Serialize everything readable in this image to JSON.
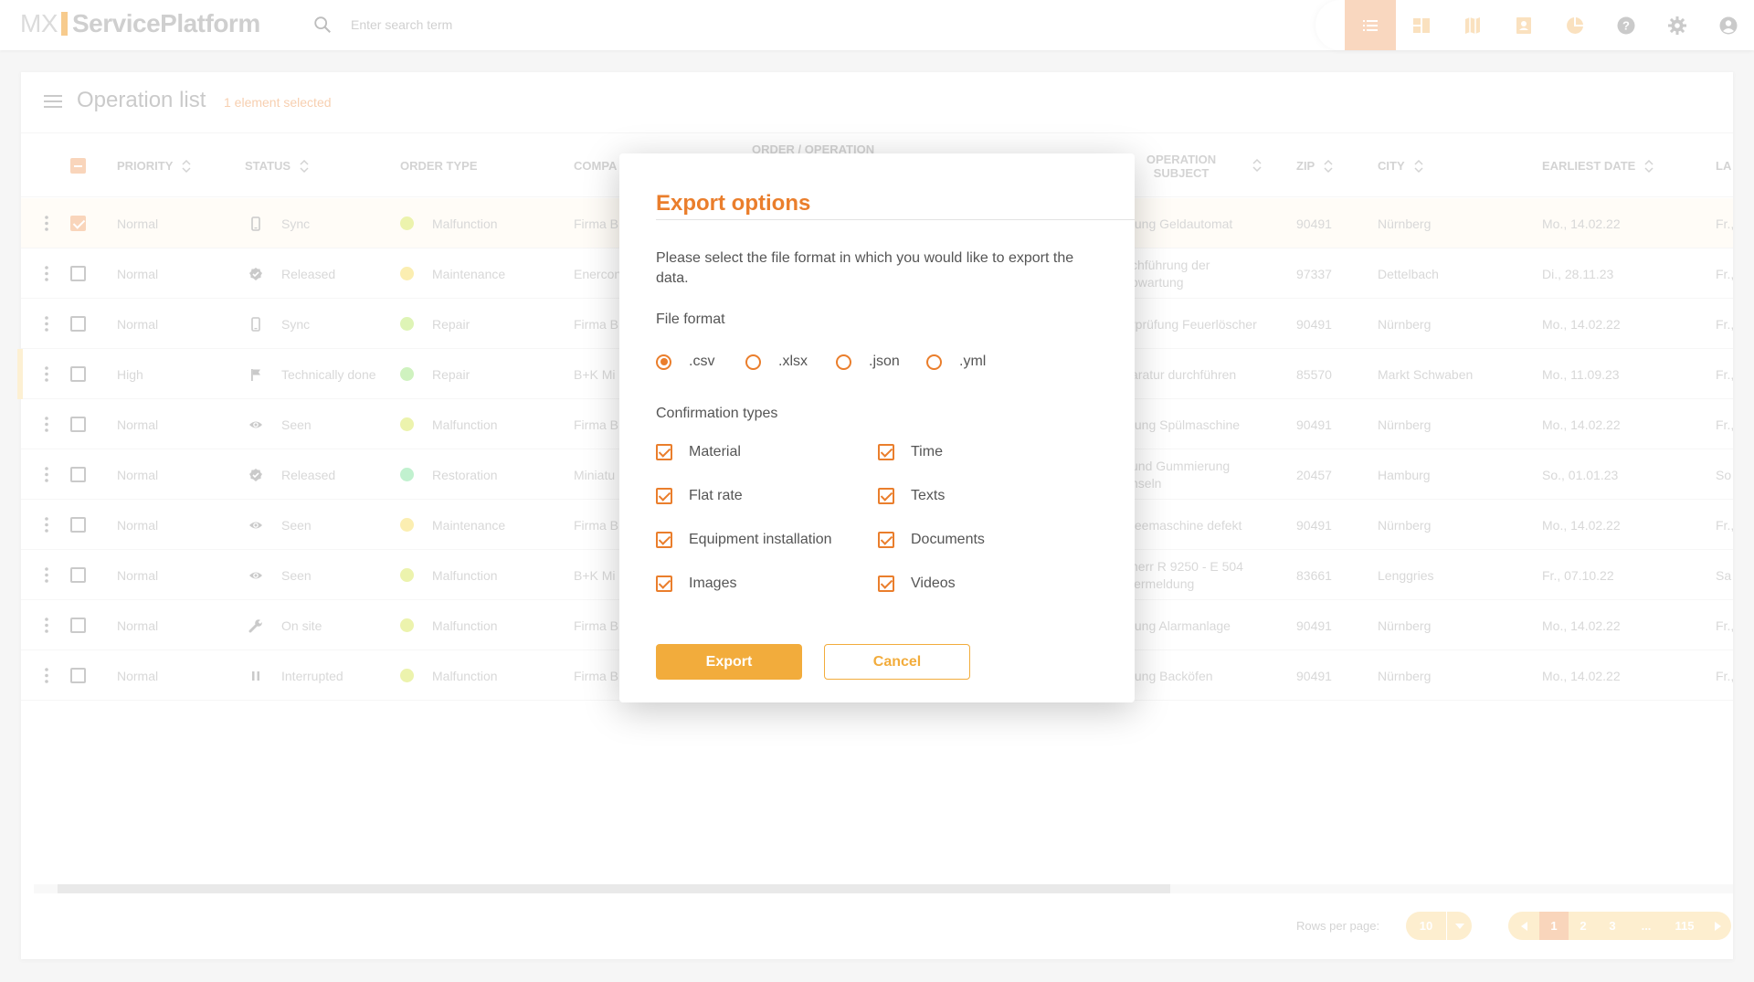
{
  "app": {
    "logo_mx": "MX",
    "logo_name": "ServicePlatform",
    "search_placeholder": "Enter search term",
    "nav": [
      {
        "name": "list-view",
        "icon": "list-icon",
        "active": true
      },
      {
        "name": "dashboard-view",
        "icon": "dashboard-icon",
        "active": false
      },
      {
        "name": "map-view",
        "icon": "map-icon",
        "active": false
      },
      {
        "name": "contacts-view",
        "icon": "contact-icon",
        "active": false
      },
      {
        "name": "reports-view",
        "icon": "pie-chart-icon",
        "active": false
      },
      {
        "name": "help",
        "icon": "help-icon",
        "active": false
      },
      {
        "name": "settings",
        "icon": "gear-icon",
        "active": false
      },
      {
        "name": "account",
        "icon": "user-icon",
        "active": false
      }
    ]
  },
  "list": {
    "title": "Operation list",
    "selected_text": "1 element selected",
    "columns": {
      "priority": "PRIORITY",
      "status": "STATUS",
      "order_type": "ORDER TYPE",
      "company": "COMPA",
      "order_operation": "ORDER / OPERATION",
      "subject_l1": "OPERATION",
      "subject_l2": "SUBJECT",
      "zip": "ZIP",
      "city": "CITY",
      "earliest_date": "EARLIEST DATE",
      "last": "LA"
    },
    "rows": [
      {
        "priority": "Normal",
        "status": "Sync",
        "status_icon": "phone-icon",
        "order_type": "Malfunction",
        "type_color": "#dde96a",
        "company": "Firma B",
        "subject": "tung Geldautomat",
        "zip": "90491",
        "city": "Nürnberg",
        "date": "Mo., 14.02.22",
        "last": "Fr.,",
        "selected": true,
        "high": false
      },
      {
        "priority": "Normal",
        "status": "Released",
        "status_icon": "verified-icon",
        "order_type": "Maintenance",
        "type_color": "#f7e171",
        "company": "Enercon",
        "subject": "chführung der\nowartung",
        "zip": "97337",
        "city": "Dettelbach",
        "date": "Di., 28.11.23",
        "last": "Fr.,",
        "selected": false,
        "high": false
      },
      {
        "priority": "Normal",
        "status": "Sync",
        "status_icon": "phone-icon",
        "order_type": "Repair",
        "type_color": "#c4ec7a",
        "company": "Firma B",
        "subject": "rprüfung Feuerlöscher",
        "zip": "90491",
        "city": "Nürnberg",
        "date": "Mo., 14.02.22",
        "last": "Fr.,",
        "selected": false,
        "high": false
      },
      {
        "priority": "High",
        "status": "Technically done",
        "status_icon": "flag-icon",
        "order_type": "Repair",
        "type_color": "#a8e88a",
        "company": "B+K Mi",
        "subject": "aratur durchführen",
        "zip": "85570",
        "city": "Markt Schwaben",
        "date": "Mo., 11.09.23",
        "last": "Fr.,",
        "selected": false,
        "high": true
      },
      {
        "priority": "Normal",
        "status": "Seen",
        "status_icon": "eye-icon",
        "order_type": "Malfunction",
        "type_color": "#dde96a",
        "company": "Firma B",
        "subject": "tung Spülmaschine",
        "zip": "90491",
        "city": "Nürnberg",
        "date": "Mo., 14.02.22",
        "last": "Fr.,",
        "selected": false,
        "high": false
      },
      {
        "priority": "Normal",
        "status": "Released",
        "status_icon": "verified-icon",
        "order_type": "Restoration",
        "type_color": "#8ee6a8",
        "company": "Miniatu",
        "subject": "und Gummierung\nhseln",
        "zip": "20457",
        "city": "Hamburg",
        "date": "So., 01.01.23",
        "last": "So",
        "selected": false,
        "high": false
      },
      {
        "priority": "Normal",
        "status": "Seen",
        "status_icon": "eye-icon",
        "order_type": "Maintenance",
        "type_color": "#f7e171",
        "company": "Firma B",
        "subject": "feemaschine defekt",
        "zip": "90491",
        "city": "Nürnberg",
        "date": "Mo., 14.02.22",
        "last": "Fr.,",
        "selected": false,
        "high": false
      },
      {
        "priority": "Normal",
        "status": "Seen",
        "status_icon": "eye-icon",
        "order_type": "Malfunction",
        "type_color": "#dde96a",
        "company": "B+K Mi",
        "subject": "herr R 9250 - E 504\nlermeldung",
        "zip": "83661",
        "city": "Lenggries",
        "date": "Fr., 07.10.22",
        "last": "Sa",
        "selected": false,
        "high": false
      },
      {
        "priority": "Normal",
        "status": "On site",
        "status_icon": "wrench-icon",
        "order_type": "Malfunction",
        "type_color": "#dde96a",
        "company": "Firma B",
        "subject": "tung Alarmanlage",
        "zip": "90491",
        "city": "Nürnberg",
        "date": "Mo., 14.02.22",
        "last": "Fr.,",
        "selected": false,
        "high": false
      },
      {
        "priority": "Normal",
        "status": "Interrupted",
        "status_icon": "pause-icon",
        "order_type": "Malfunction",
        "type_color": "#dde96a",
        "company": "Firma B",
        "subject": "tung Backöfen",
        "zip": "90491",
        "city": "Nürnberg",
        "date": "Mo., 14.02.22",
        "last": "Fr.,",
        "selected": false,
        "high": false
      }
    ],
    "footer": {
      "rows_per_page_label": "Rows per page:",
      "rows_per_page": "10",
      "pages": [
        "1",
        "2",
        "3",
        "...",
        "115"
      ],
      "current_page": "1"
    }
  },
  "dialog": {
    "title": "Export options",
    "description": "Please select the file format in which you would like to export the data.",
    "file_format_label": "File format",
    "formats": [
      {
        "label": ".csv",
        "selected": true
      },
      {
        "label": ".xlsx",
        "selected": false
      },
      {
        "label": ".json",
        "selected": false
      },
      {
        "label": ".yml",
        "selected": false
      }
    ],
    "confirmation_label": "Confirmation types",
    "confirmation_types": [
      {
        "label": "Material",
        "checked": true
      },
      {
        "label": "Time",
        "checked": true
      },
      {
        "label": "Flat rate",
        "checked": true
      },
      {
        "label": "Texts",
        "checked": true
      },
      {
        "label": "Equipment installation",
        "checked": true
      },
      {
        "label": "Documents",
        "checked": true
      },
      {
        "label": "Images",
        "checked": true
      },
      {
        "label": "Videos",
        "checked": true
      }
    ],
    "export_label": "Export",
    "cancel_label": "Cancel"
  },
  "colors": {
    "accent": "#ea7e2c",
    "button": "#f2ac3c",
    "nav_active": "#f4b78a"
  }
}
